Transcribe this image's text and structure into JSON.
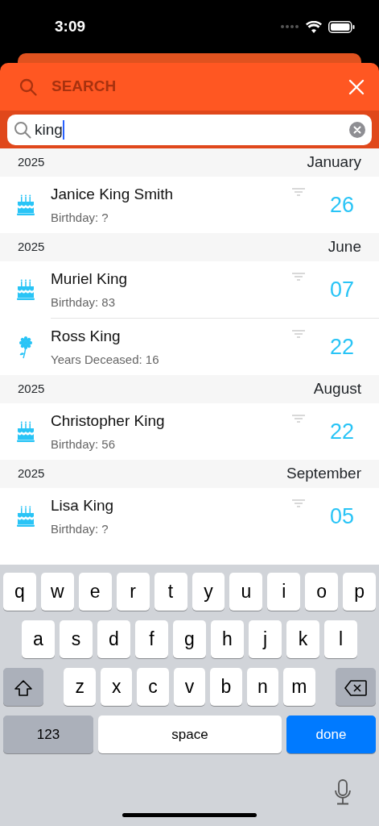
{
  "status_bar": {
    "time": "3:09"
  },
  "header": {
    "title": "SEARCH"
  },
  "search": {
    "value": "king"
  },
  "sections": [
    {
      "year": "2025",
      "month": "January",
      "entries": [
        {
          "kind": "birthday",
          "name": "Janice King Smith",
          "detail": "Birthday: ?",
          "day": "26"
        }
      ]
    },
    {
      "year": "2025",
      "month": "June",
      "entries": [
        {
          "kind": "birthday",
          "name": "Muriel King",
          "detail": "Birthday: 83",
          "day": "07"
        },
        {
          "kind": "deceased",
          "name": "Ross King",
          "detail": "Years Deceased: 16",
          "day": "22"
        }
      ]
    },
    {
      "year": "2025",
      "month": "August",
      "entries": [
        {
          "kind": "birthday",
          "name": "Christopher King",
          "detail": "Birthday: 56",
          "day": "22"
        }
      ]
    },
    {
      "year": "2025",
      "month": "September",
      "entries": [
        {
          "kind": "birthday",
          "name": "Lisa King",
          "detail": "Birthday: ?",
          "day": "05"
        }
      ]
    }
  ],
  "keyboard": {
    "rows": [
      [
        "q",
        "w",
        "e",
        "r",
        "t",
        "y",
        "u",
        "i",
        "o",
        "p"
      ],
      [
        "a",
        "s",
        "d",
        "f",
        "g",
        "h",
        "j",
        "k",
        "l"
      ],
      [
        "z",
        "x",
        "c",
        "v",
        "b",
        "n",
        "m"
      ]
    ],
    "numbers_key": "123",
    "space_key": "space",
    "done_key": "done"
  }
}
